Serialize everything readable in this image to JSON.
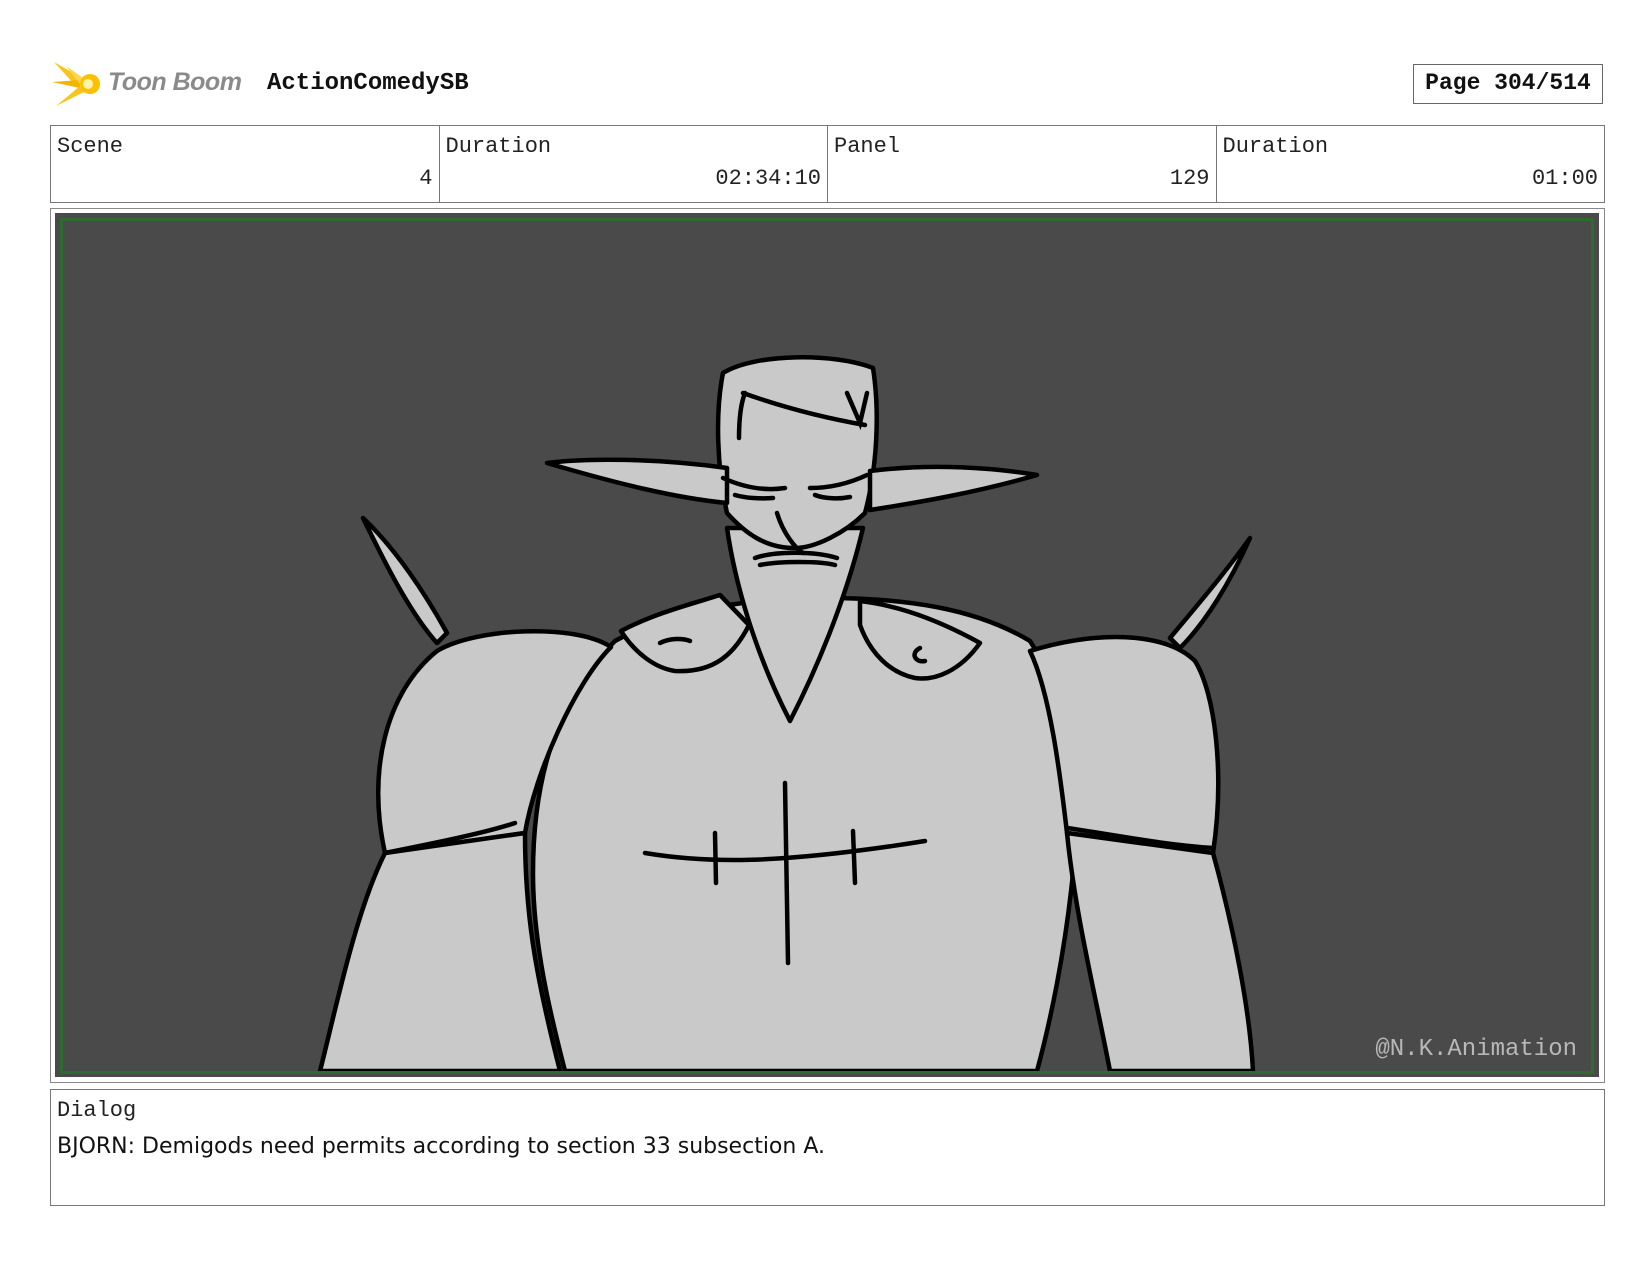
{
  "header": {
    "logo_text": "Toon Boom",
    "project_title": "ActionComedySB",
    "page_label": "Page 304/514"
  },
  "info": {
    "scene_label": "Scene",
    "scene_value": "4",
    "scene_duration_label": "Duration",
    "scene_duration_value": "02:34:10",
    "panel_label": "Panel",
    "panel_value": "129",
    "panel_duration_label": "Duration",
    "panel_duration_value": "01:00"
  },
  "panel": {
    "watermark": "@N.K.Animation",
    "background_color": "#4a4a4a",
    "safe_frame_color": "#2e6b2e",
    "figure_fill_color": "#c9c9c9"
  },
  "dialog": {
    "label": "Dialog",
    "text": "BJORN: Demigods need permits according to section 33 subsection A."
  },
  "icons": {
    "logo": "toon-boom-logo-icon"
  }
}
